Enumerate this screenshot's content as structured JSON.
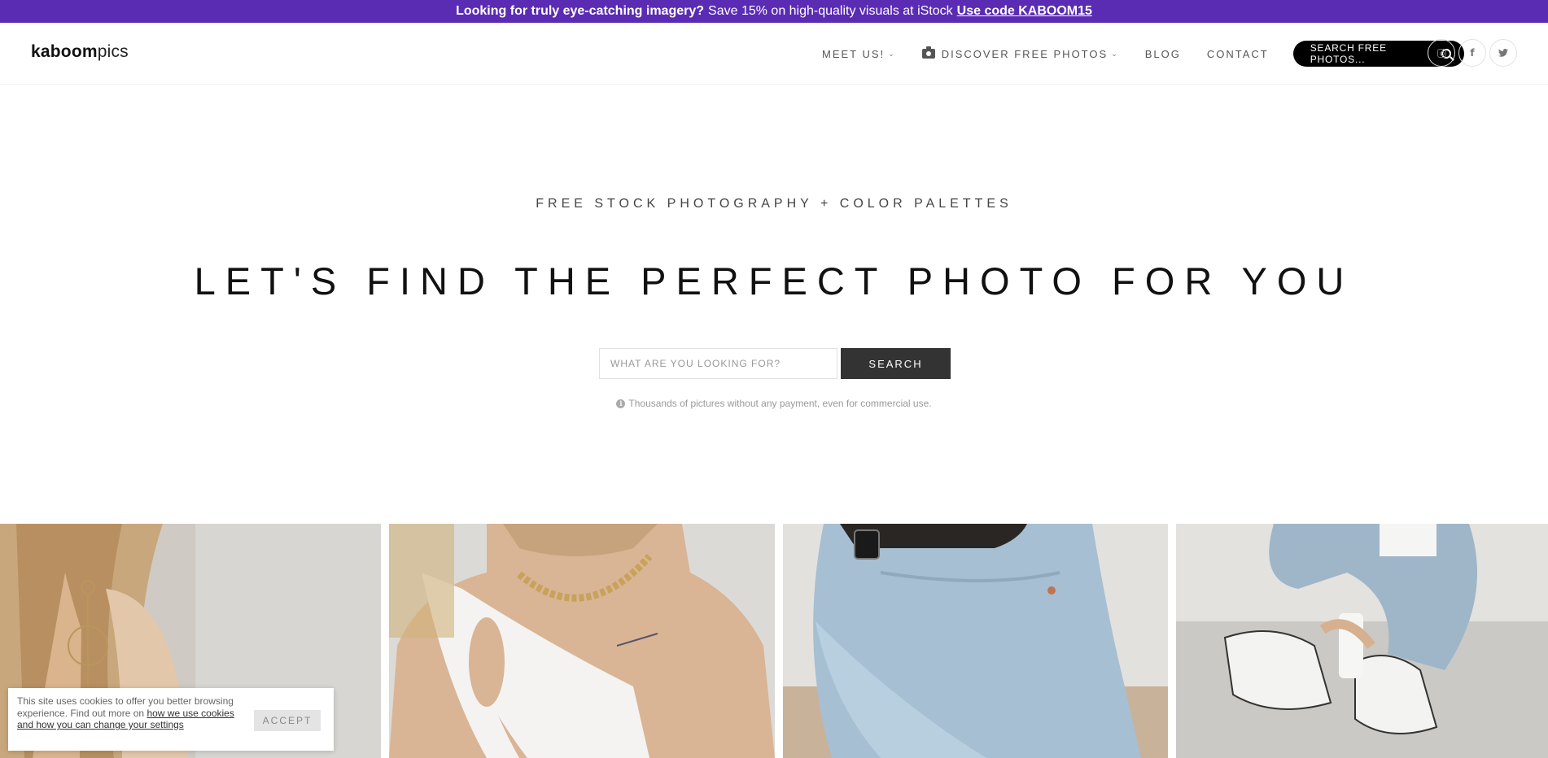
{
  "promo": {
    "lead": "Looking for truly eye-catching imagery?",
    "text": "Save 15% on high-quality visuals at iStock",
    "link": "Use code KABOOM15"
  },
  "header": {
    "logo_bold": "kaboom",
    "logo_light": "pics",
    "nav": {
      "meet": "MEET US!",
      "discover": "DISCOVER FREE PHOTOS",
      "blog": "BLOG",
      "contact": "CONTACT"
    },
    "search_pill": "SEARCH FREE PHOTOS...",
    "social": {
      "facebook": "f",
      "twitter": "t"
    }
  },
  "hero": {
    "subtitle": "FREE STOCK PHOTOGRAPHY + COLOR PALETTES",
    "title": "LET'S FIND THE PERFECT PHOTO FOR YOU",
    "search_placeholder": "WHAT ARE YOU LOOKING FOR?",
    "search_button": "SEARCH",
    "note": "Thousands of pictures without any payment, even for commercial use."
  },
  "cookie": {
    "text": "This site uses cookies to offer you better browsing experience. Find out more on",
    "link": "how we use cookies and how you can change your settings",
    "accept": "ACCEPT"
  },
  "colors": {
    "promo_bg": "#5a2bb3",
    "search_button_bg": "#333333",
    "nav_search_bg": "#000000"
  }
}
